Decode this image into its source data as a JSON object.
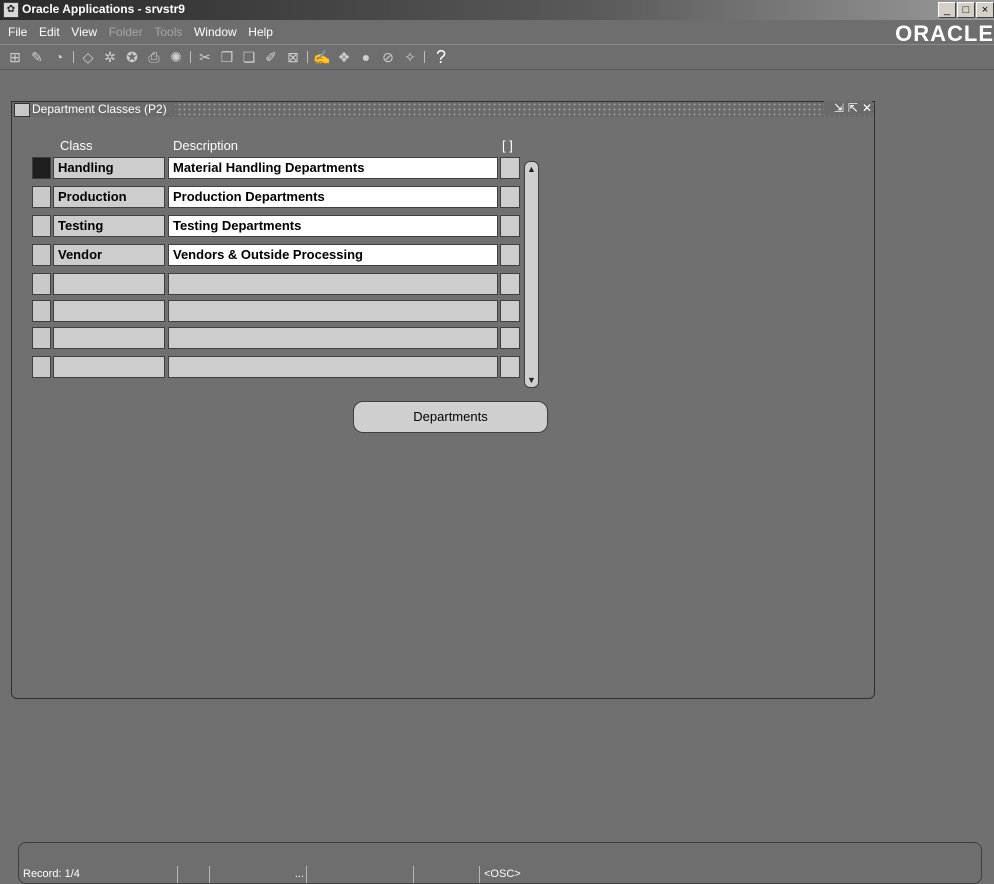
{
  "window": {
    "title": "Oracle Applications - srvstr9"
  },
  "menubar": {
    "items": [
      {
        "label": "File",
        "dim": false
      },
      {
        "label": "Edit",
        "dim": false
      },
      {
        "label": "View",
        "dim": false
      },
      {
        "label": "Folder",
        "dim": true
      },
      {
        "label": "Tools",
        "dim": true
      },
      {
        "label": "Window",
        "dim": false
      },
      {
        "label": "Help",
        "dim": false
      }
    ],
    "logo": "ORACLE"
  },
  "toolbar": {
    "help_glyph": "?"
  },
  "form": {
    "title": "Department Classes (P2)",
    "columns": {
      "class": "Class",
      "description": "Description",
      "flex": "[ ]"
    },
    "rows": [
      {
        "class": "Handling",
        "description": "Material Handling Departments"
      },
      {
        "class": "Production",
        "description": "Production Departments"
      },
      {
        "class": "Testing",
        "description": "Testing Departments"
      },
      {
        "class": "Vendor",
        "description": "Vendors & Outside Processing"
      },
      {
        "class": "",
        "description": ""
      },
      {
        "class": "",
        "description": ""
      },
      {
        "class": "",
        "description": ""
      },
      {
        "class": "",
        "description": ""
      }
    ],
    "button_label": "Departments"
  },
  "status": {
    "record": "Record: 1/4",
    "ellipsis": "...",
    "mode": "<OSC>"
  },
  "colors": {
    "background": "#707070",
    "field": "#cdcdcd",
    "active_field": "#ffffff"
  }
}
